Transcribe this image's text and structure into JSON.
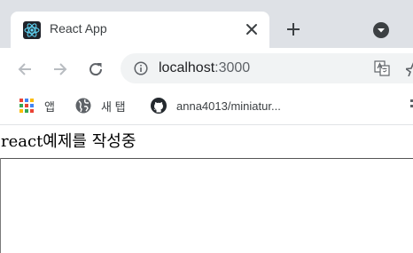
{
  "colors": {
    "tabstrip_bg": "#dee1e6",
    "omnibox_bg": "#f1f3f4",
    "react_logo": "#61dafb",
    "icon_gray": "#5f6368",
    "disabled_gray": "#b8bcc1"
  },
  "tab": {
    "title": "React App",
    "favicon": "react-logo-icon"
  },
  "toolbar": {
    "url_host": "localhost",
    "url_port": ":3000"
  },
  "bookmarks": {
    "items": [
      {
        "label": "앱",
        "icon": "apps-grid-icon"
      },
      {
        "label": "새 탭",
        "icon": "globe-icon"
      },
      {
        "label": "anna4013/miniatur...",
        "icon": "github-icon"
      }
    ]
  },
  "page": {
    "heading": "react예제를 작성중"
  }
}
